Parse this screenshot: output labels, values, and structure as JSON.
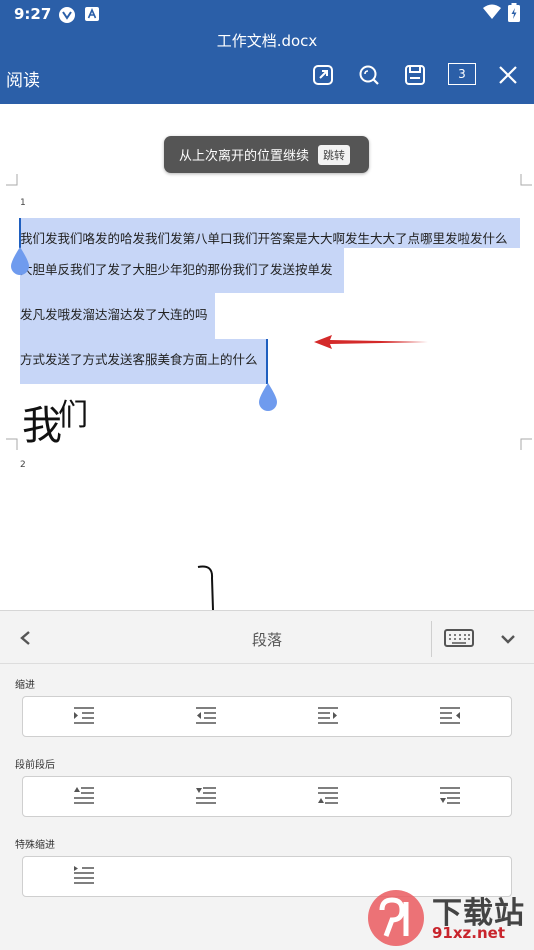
{
  "status_bar": {
    "time": "9:27"
  },
  "header": {
    "doc_title": "工作文档.docx",
    "mode_label": "阅读",
    "page_count": "3"
  },
  "document": {
    "toast": {
      "text": "从上次离开的位置继续",
      "jump_label": "跳转"
    },
    "page1_number": "1",
    "page2_number": "2",
    "lines": [
      "我们发我们咯发的哈发我们发第八单口我们开答案是大大啊发生大大了点哪里发啦发什么",
      "大胆单反我们了发了大胆少年犯的那份我们了发送按单发",
      "发凡发哦发溜达溜达发了大连的吗",
      "方式发送了方式发送客服美食方面上的什么"
    ],
    "big_text_main": "我",
    "big_text_small": "们"
  },
  "panel": {
    "title": "段落",
    "sections": [
      {
        "label": "缩进"
      },
      {
        "label": "段前段后"
      },
      {
        "label": "特殊缩进"
      }
    ]
  },
  "watermark": {
    "top": "下载站",
    "bottom": "91xz.net"
  },
  "colors": {
    "header_bg": "#2b5fa8",
    "selection": "#c7d6f7",
    "handle": "#6f9bee",
    "arrow": "#d42a2a"
  }
}
